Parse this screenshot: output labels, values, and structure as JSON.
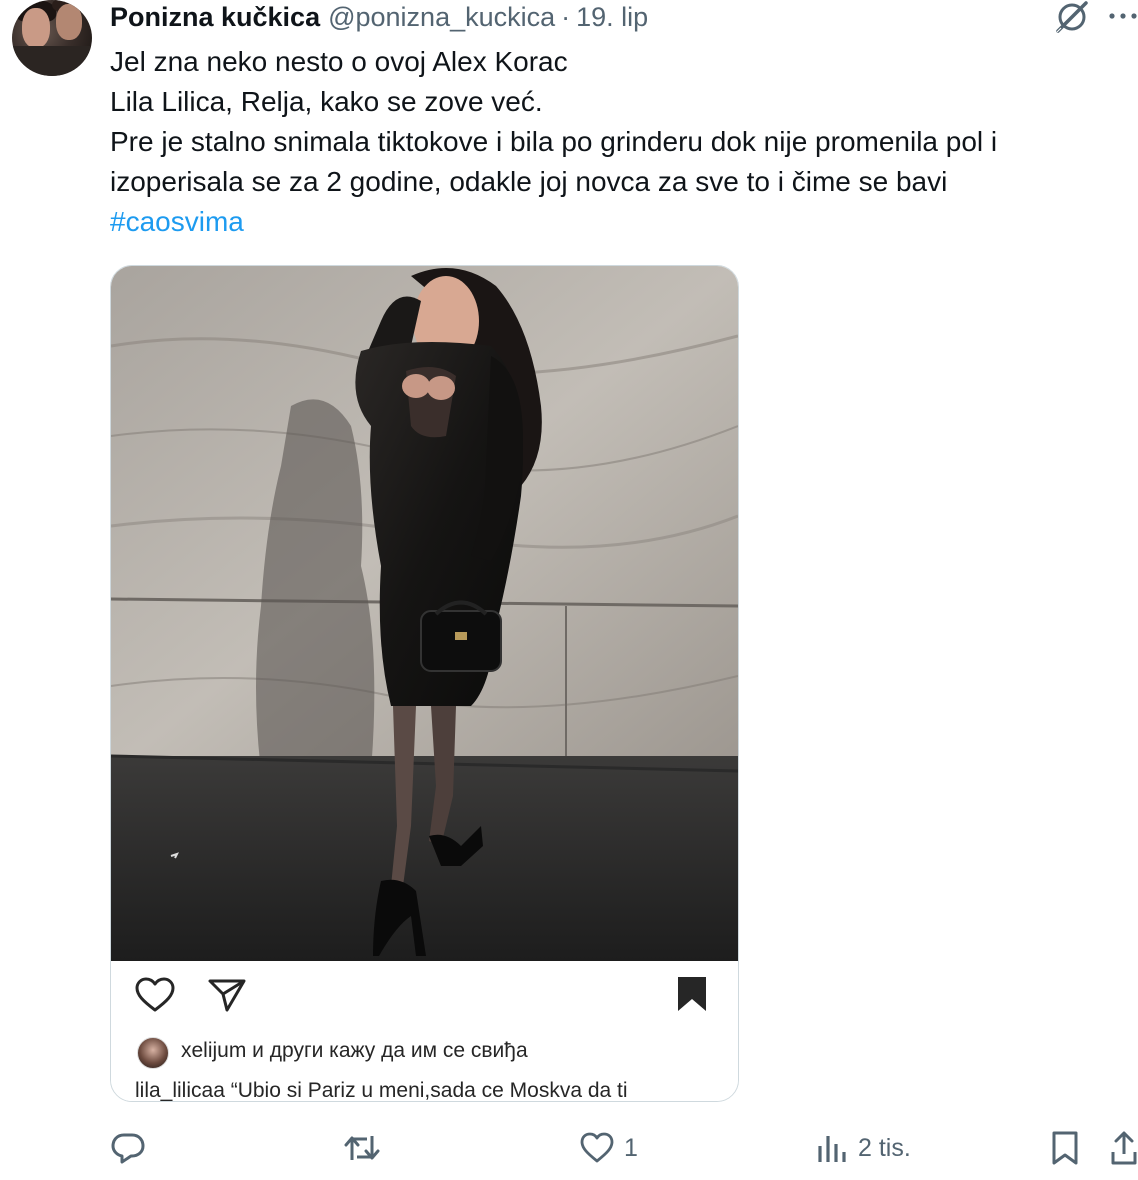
{
  "tweet": {
    "author": {
      "display_name": "Ponizna kučkica",
      "handle": "@ponizna_kuckica",
      "separator": "·",
      "date": "19. lip",
      "avatar_icon": "avatar"
    },
    "text_lines": [
      "Jel zna neko nesto o ovoj Alex Korac",
      "Lila Lilica, Relja, kako se zove već.",
      "Pre je stalno snimala tiktokove i bila po grinderu dok nije promenila pol i",
      "izoperisala se za 2 godine, odakle joj novca za sve to i čime se bavi"
    ],
    "hashtag": "#caosvima",
    "hashtag_color": "#1d9bf0"
  },
  "embedded_post": {
    "likes_text": "xelijum и други кажу да им се свиђа",
    "caption": "lila_lilicaa “Ubio si Pariz u meni,sada ce Moskva da ti"
  },
  "actions": {
    "reply_icon": "reply-icon",
    "retweet_icon": "retweet-icon",
    "likes_count": "1",
    "views_count": "2 tis.",
    "bookmark_icon": "bookmark-icon",
    "share_icon": "share-icon"
  },
  "colors": {
    "text": "#0f1419",
    "secondary": "#536471",
    "border": "#cfd9de"
  }
}
